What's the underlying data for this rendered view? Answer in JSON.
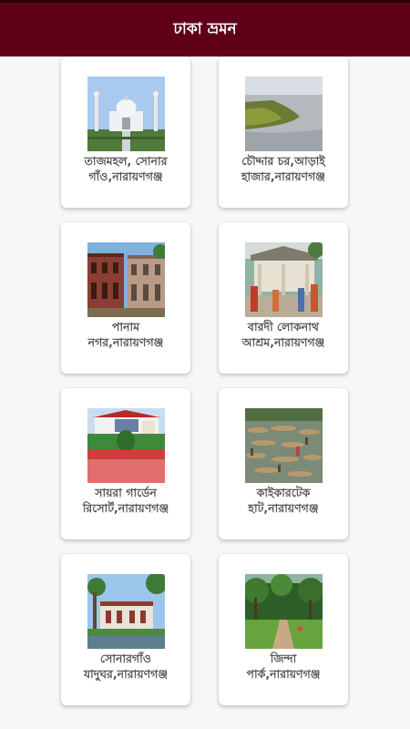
{
  "app": {
    "title": "ঢাকা ভ্রমন"
  },
  "places": [
    {
      "line1": "তাজমহল, সোনার",
      "line2": "গাঁও,নারায়ণগঞ্জ",
      "image": "taj-mahal-replica-image"
    },
    {
      "line1": "চৌদ্দার চর,আড়াই",
      "line2": "হাজার,নারায়ণগঞ্জ",
      "image": "river-char-image"
    },
    {
      "line1": "পানাম",
      "line2": "নগর,নারায়ণগঞ্জ",
      "image": "panam-nagar-image"
    },
    {
      "line1": "বারদী লোকনাথ",
      "line2": "আশ্রম,নারায়ণগঞ্জ",
      "image": "lokenath-ashram-image"
    },
    {
      "line1": "সায়রা গার্ডেন",
      "line2": "রিসোর্ট,নারায়ণগঞ্জ",
      "image": "garden-resort-image"
    },
    {
      "line1": "কাইকারটেক",
      "line2": "হাট,নারায়ণগঞ্জ",
      "image": "boat-market-image"
    },
    {
      "line1": "সোনারগাঁও",
      "line2": "যাদুঘর,নারায়ণগঞ্জ",
      "image": "museum-image"
    },
    {
      "line1": "জিন্দা",
      "line2": "পার্ক,নারায়ণগঞ্জ",
      "image": "park-image"
    }
  ]
}
